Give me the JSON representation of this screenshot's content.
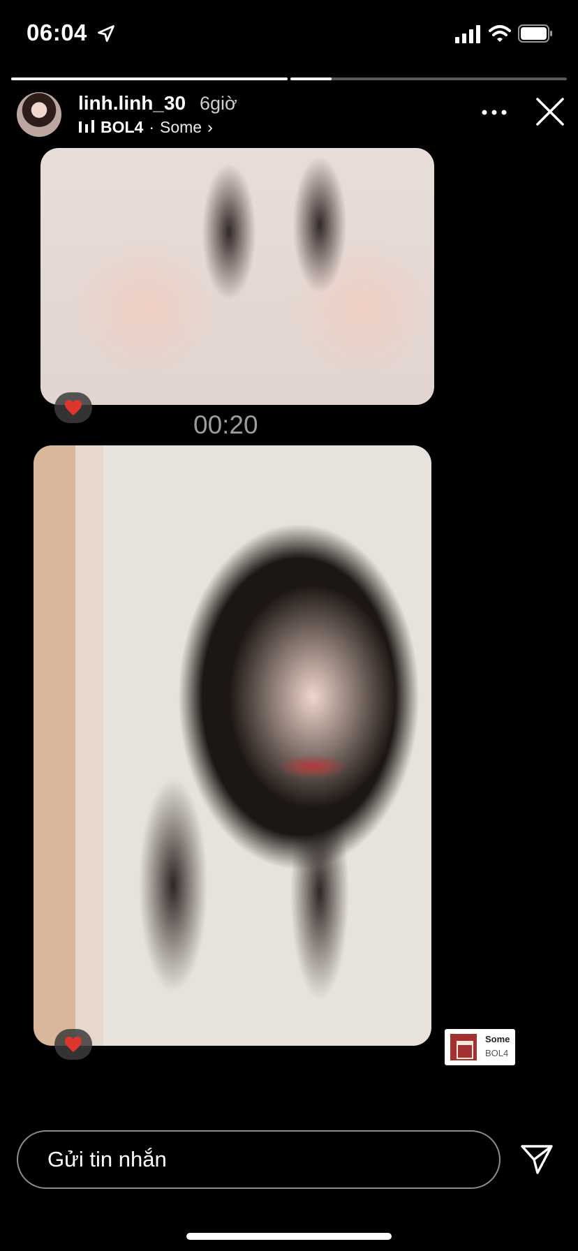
{
  "status_bar": {
    "time": "06:04",
    "icons": [
      "location-arrow-icon",
      "cellular-signal-icon",
      "wifi-icon",
      "battery-icon"
    ]
  },
  "story": {
    "segments": [
      {
        "progress": 1.0
      },
      {
        "progress": 0.15
      }
    ],
    "username": "linh.linh_30",
    "posted_ago": "6giờ",
    "music": {
      "artist": "BOL4",
      "separator": "·",
      "song": "Some",
      "chevron": "›"
    },
    "timer": "00:20",
    "sticker": {
      "song": "Some",
      "artist": "BOL4"
    }
  },
  "reply": {
    "placeholder": "Gửi tin nhắn"
  },
  "colors": {
    "background": "#000000",
    "heart": "#e0342f",
    "timer_text": "#9c9c9c"
  }
}
